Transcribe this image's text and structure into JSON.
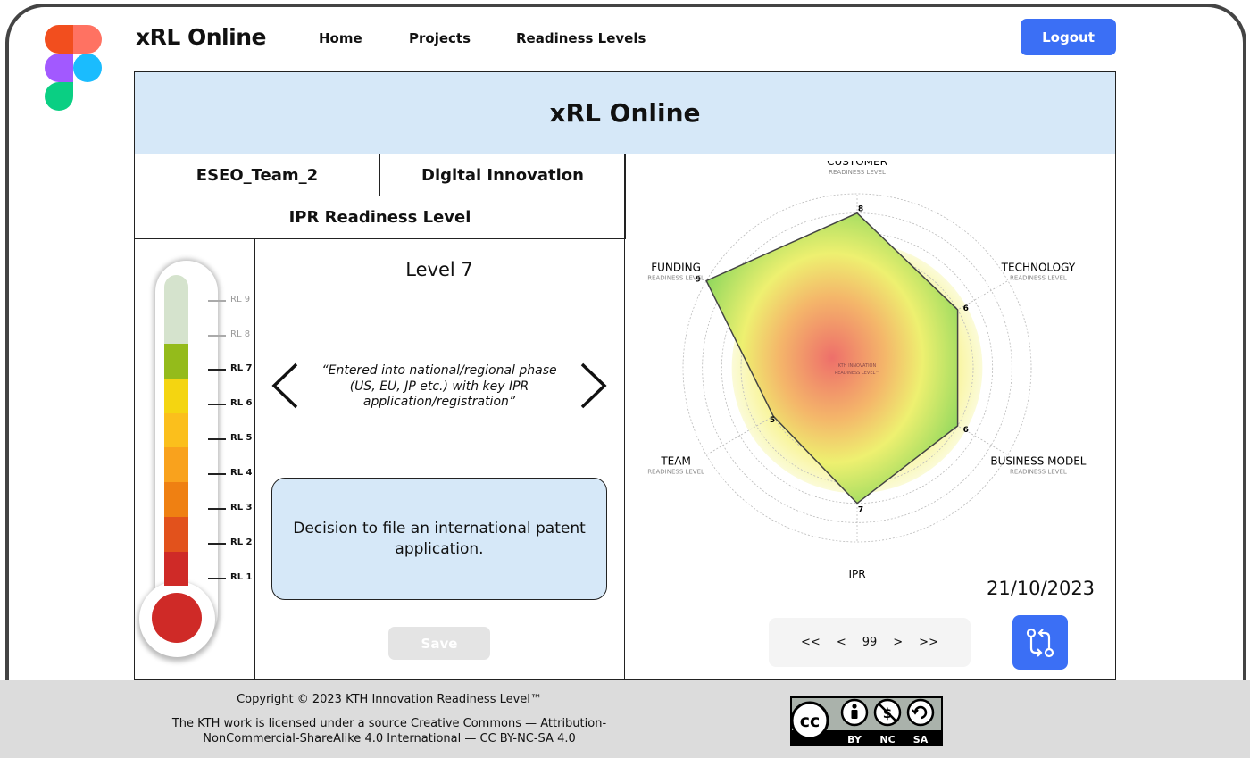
{
  "nav": {
    "brand": "xRL Online",
    "links": [
      "Home",
      "Projects",
      "Readiness Levels"
    ],
    "logout": "Logout"
  },
  "hero": {
    "title": "xRL Online"
  },
  "project": {
    "team": "ESEO_Team_2",
    "category": "Digital Innovation",
    "readiness_type": "IPR Readiness Level"
  },
  "thermometer": {
    "labels": [
      "RL 9",
      "RL 8",
      "RL 7",
      "RL 6",
      "RL 5",
      "RL 4",
      "RL 3",
      "RL 2",
      "RL 1"
    ],
    "current_level": 7
  },
  "level": {
    "title": "Level 7",
    "quote": "“Entered into national/regional phase (US, EU, JP etc.) with key IPR application/registration”",
    "decision": "Decision to file an international patent application."
  },
  "save_label": "Save",
  "radar": {
    "axes": [
      {
        "name": "CUSTOMER",
        "sub": "READINESS LEVEL",
        "value": 8
      },
      {
        "name": "TECHNOLOGY",
        "sub": "READINESS LEVEL",
        "value": 6
      },
      {
        "name": "BUSINESS MODEL",
        "sub": "READINESS LEVEL",
        "value": 6
      },
      {
        "name": "IPR",
        "sub": "READINESS LEVEL",
        "value": 7
      },
      {
        "name": "TEAM",
        "sub": "READINESS LEVEL",
        "value": 5
      },
      {
        "name": "FUNDING",
        "sub": "READINESS LEVEL",
        "value": 9
      }
    ],
    "center_text": "KTH INNOVATION READINESS LEVEL™",
    "max": 9
  },
  "date": "21/10/2023",
  "pager": {
    "first": "<<",
    "prev": "<",
    "page": "99",
    "next": ">",
    "last": ">>"
  },
  "footer": {
    "copyright": "Copyright © 2023 KTH Innovation Readiness Level™",
    "license_line1": "The KTH work is licensed under a source Creative Commons — Attribution-",
    "license_line2": "NonCommercial-ShareAlike 4.0 International — CC BY-NC-SA 4.0",
    "badge": [
      "BY",
      "NC",
      "SA"
    ]
  },
  "colors": {
    "accent": "#3b6ff5",
    "panel": "#d6e8f8",
    "footer": "#dcdcdc"
  }
}
